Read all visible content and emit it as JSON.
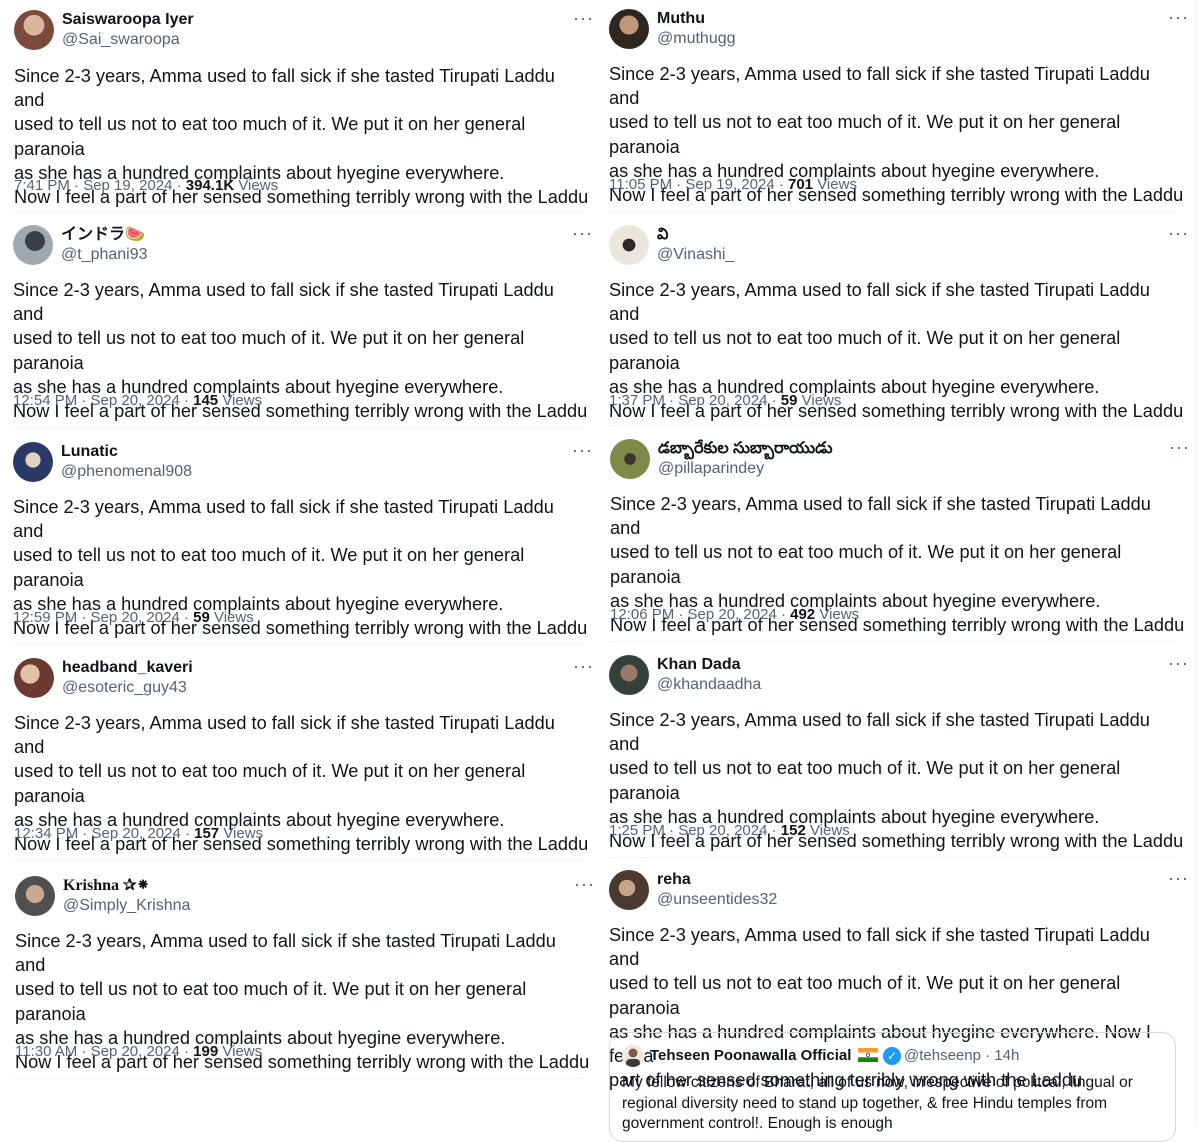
{
  "tweet_text": "Since 2-3 years, Amma used to fall sick if she tasted Tirupati Laddu and\nused to tell us not to eat too much of it. We put it on her general paranoia\nas she has a hundred complaints about hyegine everywhere.\nNow I feel a part of her sensed something terribly wrong with the Laddu",
  "more_label": "···",
  "views_label": "Views",
  "left_column": [
    {
      "name": "Saiswaroopa Iyer",
      "handle": "@Sai_swaroopa",
      "time": "7:41 PM · Sep 19, 2024 · ",
      "views": "394.1K",
      "avatar_color": "#b98a72"
    },
    {
      "name": "インドラ🍉",
      "handle": "@t_phani93",
      "time": "12:54 PM · Sep 20, 2024 · ",
      "views": "145",
      "avatar_color": "#5b6470"
    },
    {
      "name": "Lunatic",
      "handle": "@phenomenal908",
      "time": "12:59 PM · Sep 20, 2024 · ",
      "views": "59",
      "avatar_color": "#3b4f78"
    },
    {
      "name": "headband_kaveri",
      "handle": "@esoteric_guy43",
      "time": "12:34 PM · Sep 20, 2024 · ",
      "views": "157",
      "avatar_color": "#8c5a48"
    },
    {
      "name": "Krishna ✰⁕",
      "handle": "@Simply_Krishna",
      "time": "11:30 AM · Sep 20, 2024 · ",
      "views": "199",
      "avatar_color": "#6e6258"
    }
  ],
  "right_column": [
    {
      "name": "Muthu",
      "handle": "@muthugg",
      "time": "11:05 PM · Sep 19, 2024 · ",
      "views": "701",
      "avatar_color": "#4a4036"
    },
    {
      "name": "వి",
      "handle": "@Vinashi_",
      "time": "1:37 PM · Sep 20, 2024 · ",
      "views": "59",
      "avatar_color": "#e8e2da"
    },
    {
      "name": "డబ్బారేకుల సుబ్బారాయుడు",
      "handle": "@pillaparindey",
      "time": "12:06 PM · Sep 20, 2024 · ",
      "views": "492",
      "avatar_color": "#6f7a3e"
    },
    {
      "name": "Khan Dada",
      "handle": "@khandaadha",
      "time": "1:25 PM · Sep 20, 2024 · ",
      "views": "152",
      "avatar_color": "#3f4a44"
    },
    {
      "name": "reha",
      "handle": "@unseentides32",
      "avatar_color": "#5a4a3e",
      "text": "Since 2-3 years, Amma used to fall sick if she tasted Tirupati Laddu and\nused to tell us not to eat too much of it. We put it on her general paranoia\nas she has a hundred complaints about hyegine everywhere. Now I feel a\npart of her sensed something terribly wrong with the Laddu"
    }
  ],
  "quote": {
    "name": "Tehseen Poonawalla Official",
    "handle": "@tehseenp · 14h",
    "text": "My fellow citizens of Bharat, all of us now, irrespective of politcal, lingual or regional diversity need to stand up together, & free Hindu temples from government control!. Enough is enough"
  }
}
